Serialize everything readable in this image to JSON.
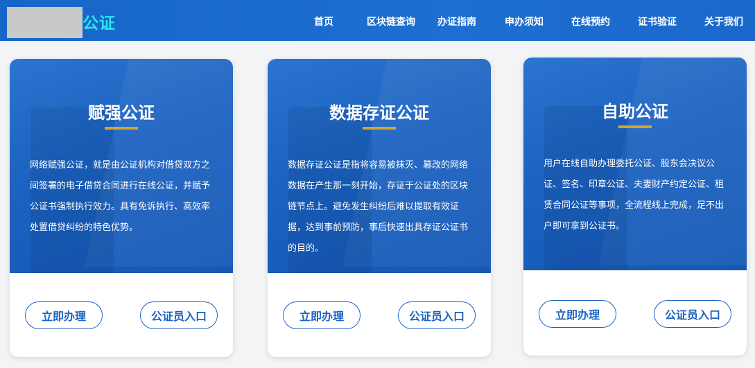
{
  "header": {
    "logo_text": "公证",
    "nav": [
      {
        "label": "首页"
      },
      {
        "label": "区块链查询"
      },
      {
        "label": "办证指南"
      },
      {
        "label": "申办须知"
      },
      {
        "label": "在线预约"
      },
      {
        "label": "证书验证"
      },
      {
        "label": "关于我们"
      }
    ]
  },
  "colors": {
    "header_bg": "#1d6fd1",
    "logo_text": "#2ee6f0",
    "card_blue": "#1c62c0",
    "underline_gold": "#d9a520",
    "button_border": "#1c63c2"
  },
  "cards": [
    {
      "title": "赋强公证",
      "description": "网络赋强公证，就是由公证机构对借贷双方之间签署的电子借贷合同进行在线公证，并赋予公证书强制执行效力。具有免诉执行、高效率处置借贷纠纷的特色优势。",
      "primary_button": "立即办理",
      "secondary_button": "公证员入口"
    },
    {
      "title": "数据存证公证",
      "description": "数据存证公证是指将容易被抹灭、篡改的网络数据在产生那一刻开始，存证于公证处的区块链节点上。避免发生纠纷后难以提取有效证据，达到事前预防，事后快速出具存证公证书的目的。",
      "primary_button": "立即办理",
      "secondary_button": "公证员入口"
    },
    {
      "title": "自助公证",
      "description": "用户在线自助办理委托公证、股东会决议公证、签名、印章公证、夫妻财产约定公证、租赁合同公证等事项，全流程线上完成，足不出户即可拿到公证书。",
      "primary_button": "立即办理",
      "secondary_button": "公证员入口"
    }
  ]
}
